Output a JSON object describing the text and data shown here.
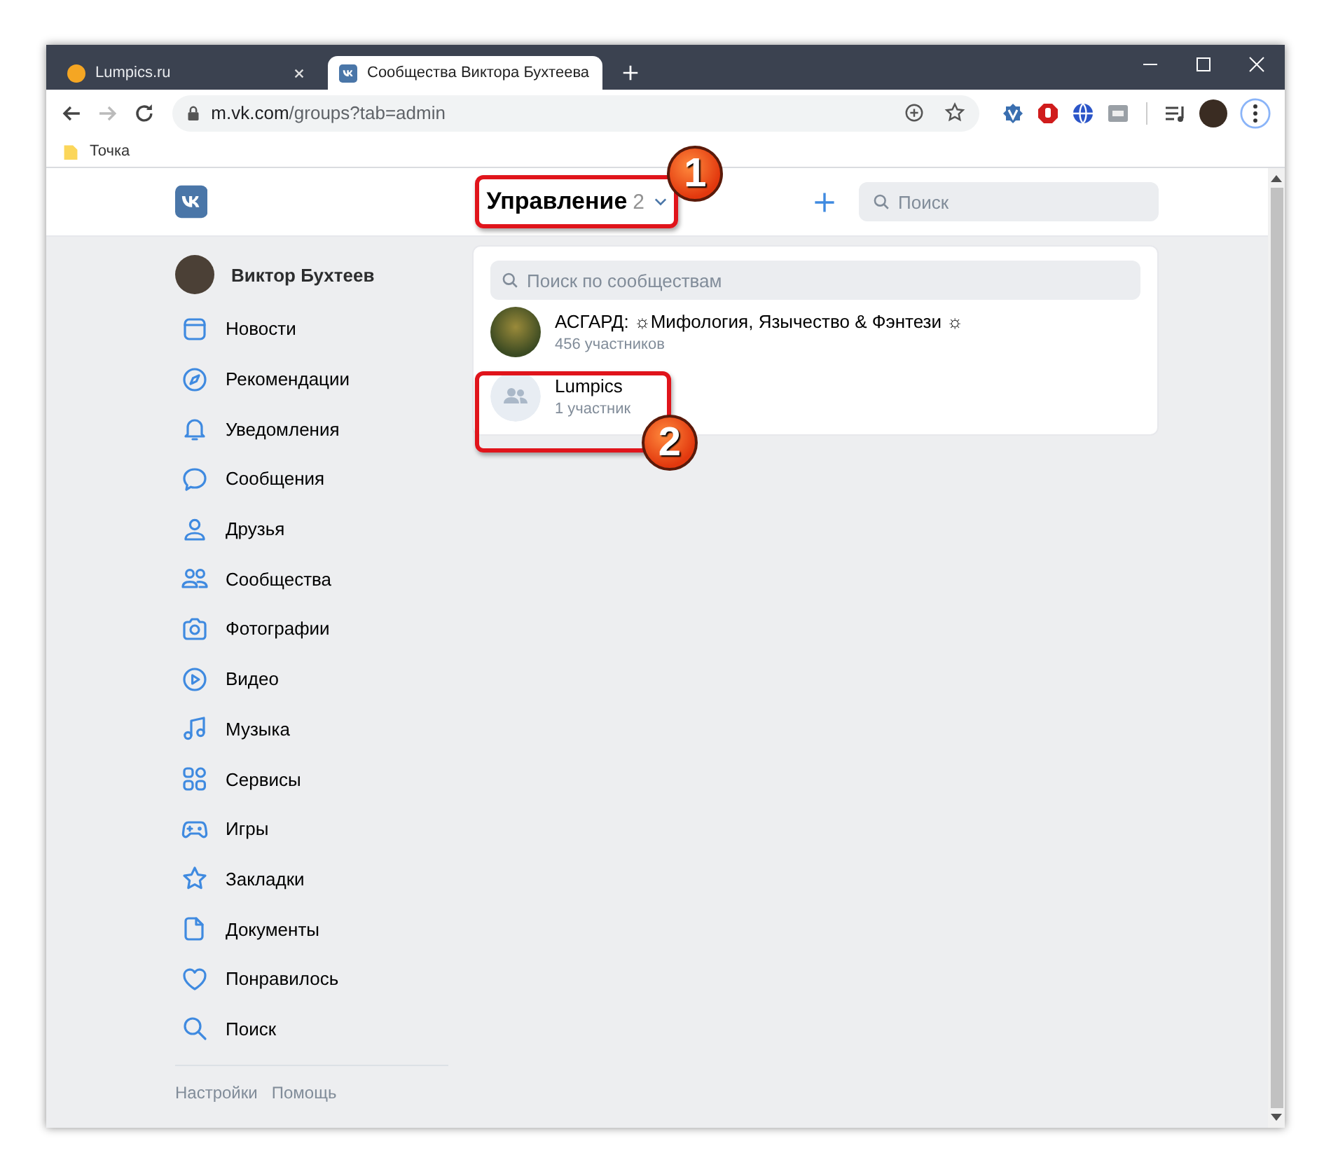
{
  "browser": {
    "tabs": [
      {
        "title": "Lumpics.ru",
        "selected": false
      },
      {
        "title": "Сообщества Виктора Бухтеева",
        "selected": true
      }
    ],
    "address": {
      "host": "m.vk.com",
      "path": "/groups?tab=admin"
    },
    "bookmarks": [
      {
        "label": "Точка"
      }
    ]
  },
  "header": {
    "title": "Управление",
    "count": "2",
    "search": {
      "placeholder": "Поиск"
    }
  },
  "sidebar": {
    "user": "Виктор Бухтеев",
    "items": [
      {
        "label": "Новости"
      },
      {
        "label": "Рекомендации"
      },
      {
        "label": "Уведомления"
      },
      {
        "label": "Сообщения"
      },
      {
        "label": "Друзья"
      },
      {
        "label": "Сообщества"
      },
      {
        "label": "Фотографии"
      },
      {
        "label": "Видео"
      },
      {
        "label": "Музыка"
      },
      {
        "label": "Сервисы"
      },
      {
        "label": "Игры"
      },
      {
        "label": "Закладки"
      },
      {
        "label": "Документы"
      },
      {
        "label": "Понравилось"
      },
      {
        "label": "Поиск"
      }
    ],
    "footer": [
      "Настройки",
      "Помощь"
    ]
  },
  "dropdown": {
    "search": {
      "placeholder": "Поиск по сообществам"
    },
    "groups": [
      {
        "name": "АСГАРД: ☼Мифология, Язычество & Фэнтези ☼",
        "members": "456 участников",
        "kind": "photo"
      },
      {
        "name": "Lumpics",
        "members": "1 участник",
        "kind": "default"
      }
    ]
  },
  "annotations": [
    {
      "number": "1"
    },
    {
      "number": "2"
    }
  ]
}
